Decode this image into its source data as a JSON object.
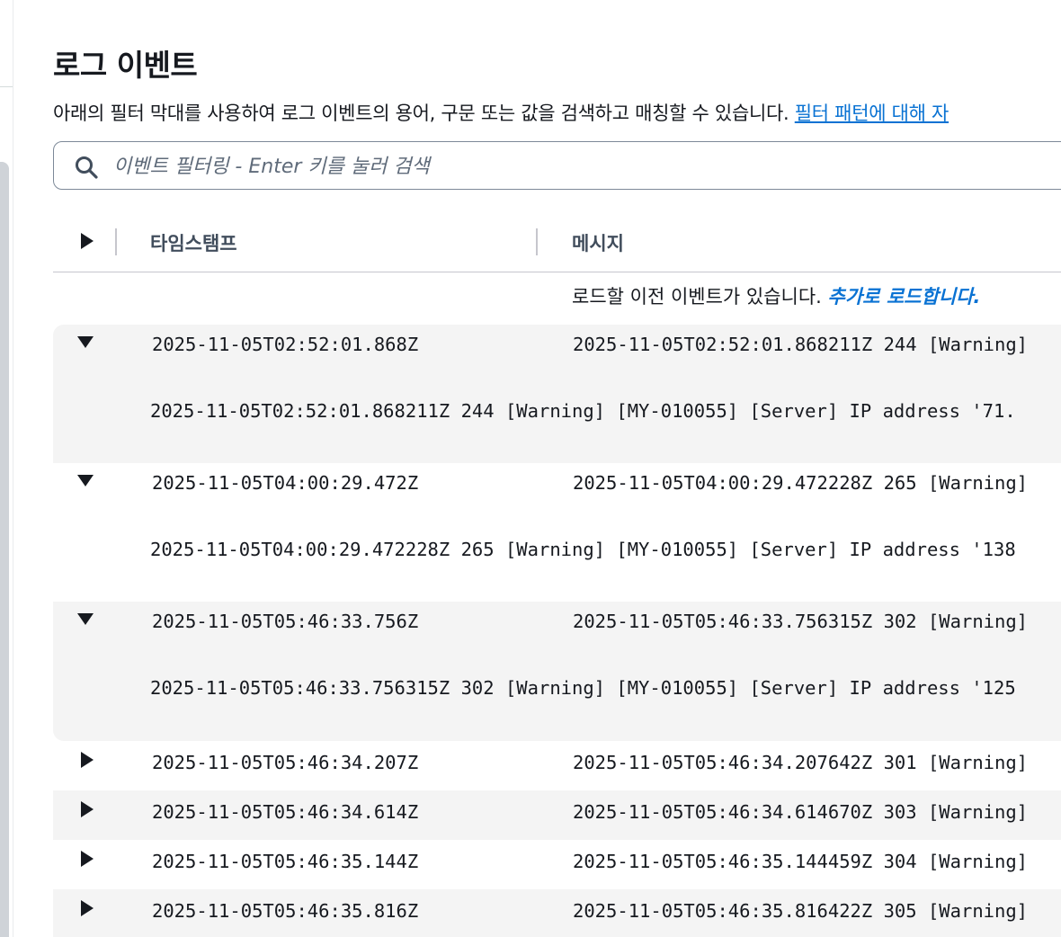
{
  "header": {
    "title": "로그 이벤트",
    "description": "아래의 필터 막대를 사용하여 로그 이벤트의 용어, 구문 또는 값을 검색하고 매칭할 수 있습니다. ",
    "description_link": "필터 패턴에 대해 자"
  },
  "search": {
    "placeholder": "이벤트 필터링 - Enter 키를 눌러 검색",
    "icon": "search-icon"
  },
  "table": {
    "columns": [
      "타임스탬프",
      "메시지"
    ],
    "load_more_text": "로드할 이전 이벤트가 있습니다. ",
    "load_more_link": "추가로 로드합니다."
  },
  "events": [
    {
      "timestamp": "2025-11-05T02:52:01.868Z",
      "message": "2025-11-05T02:52:01.868211Z 244 [Warning]",
      "detail": "2025-11-05T02:52:01.868211Z 244 [Warning] [MY-010055] [Server] IP address '71.",
      "expanded": true
    },
    {
      "timestamp": "2025-11-05T04:00:29.472Z",
      "message": "2025-11-05T04:00:29.472228Z 265 [Warning]",
      "detail": "2025-11-05T04:00:29.472228Z 265 [Warning] [MY-010055] [Server] IP address '138",
      "expanded": true
    },
    {
      "timestamp": "2025-11-05T05:46:33.756Z",
      "message": "2025-11-05T05:46:33.756315Z 302 [Warning]",
      "detail": "2025-11-05T05:46:33.756315Z 302 [Warning] [MY-010055] [Server] IP address '125",
      "expanded": true
    },
    {
      "timestamp": "2025-11-05T05:46:34.207Z",
      "message": "2025-11-05T05:46:34.207642Z 301 [Warning]",
      "expanded": false
    },
    {
      "timestamp": "2025-11-05T05:46:34.614Z",
      "message": "2025-11-05T05:46:34.614670Z 303 [Warning]",
      "expanded": false
    },
    {
      "timestamp": "2025-11-05T05:46:35.144Z",
      "message": "2025-11-05T05:46:35.144459Z 304 [Warning]",
      "expanded": false
    },
    {
      "timestamp": "2025-11-05T05:46:35.816Z",
      "message": "2025-11-05T05:46:35.816422Z 305 [Warning]",
      "expanded": false
    }
  ],
  "colors": {
    "link": "#0972d3",
    "row_highlight": "#f4f4f4",
    "header_text": "#414d5c"
  }
}
